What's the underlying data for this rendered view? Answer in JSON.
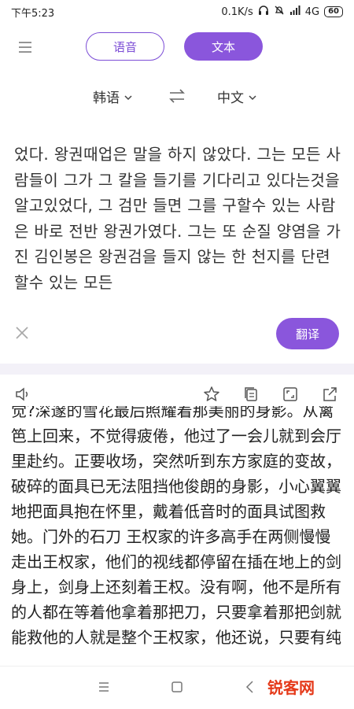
{
  "status": {
    "time": "下午5:23",
    "network_speed": "0.1K/s",
    "signal": "4G",
    "battery": "60"
  },
  "top_bar": {
    "voice_label": "语音",
    "text_label": "文本"
  },
  "languages": {
    "source": "韩语",
    "target": "中文"
  },
  "source_text": "었다. 왕권때업은 말을 하지 않았다. 그는 모든 사람들이 그가 그 칼을 들기를 기다리고 있다는것을 알고있었다, 그 검만 들면 그를 구할수 있는 사람은 바로 전반 왕권가였다. 그는 또 순질 양염을 가진 김인봉은 왕권검을 들지 않는 한 천지를 단련할수 있는 모든",
  "translate_label": "翻译",
  "result_text": "觉?深邃的雪花最后照耀着那美丽的身影。从篱笆上回来，不觉得疲倦，他过了一会儿就到会厅里赴约。正要收场，突然听到东方家庭的变故，破碎的面具已无法阻挡他俊朗的身影，小心翼翼地把面具抱在怀里，戴着低音时的面具试图救她。门外的石刀 王权家的许多高手在两侧慢慢走出王权家，他们的视线都停留在插在地上的剑身上，剑身上还刻着王权。没有啊，他不是所有的人都在等着他拿着那把刀，只要拿着那把剑就能救他的人就是整个王权家，他还说，只要有纯",
  "watermark": "锐客网",
  "colors": {
    "accent": "#8a56dc",
    "watermark": "#e53a1a"
  }
}
